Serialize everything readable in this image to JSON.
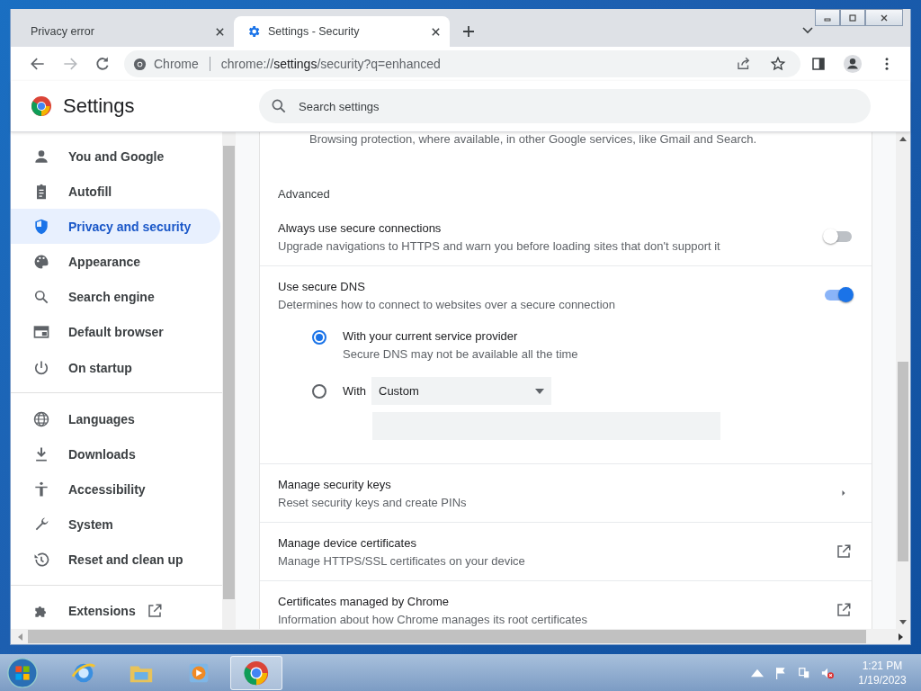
{
  "tabs": [
    {
      "label": "Privacy error",
      "selected": false
    },
    {
      "label": "Settings - Security",
      "selected": true
    }
  ],
  "toolbar": {
    "nav": [
      {
        "disabled": false
      },
      {
        "disabled": true
      },
      {
        "disabled": false
      }
    ],
    "site_chip": "Chrome",
    "url": [
      {
        "text": "chrome://",
        "emphasized": false
      },
      {
        "text": "settings",
        "emphasized": true
      },
      {
        "text": "/security?q=enhanced",
        "emphasized": false
      }
    ]
  },
  "settings": {
    "title": "Settings",
    "search": {
      "placeholder": "Search settings"
    }
  },
  "sidebar": {
    "groups": [
      [
        {
          "label": "You and Google",
          "selected": false
        },
        {
          "label": "Autofill",
          "selected": false
        },
        {
          "label": "Privacy and security",
          "selected": true
        },
        {
          "label": "Appearance",
          "selected": false
        },
        {
          "label": "Search engine",
          "selected": false
        },
        {
          "label": "Default browser",
          "selected": false
        },
        {
          "label": "On startup",
          "selected": false
        }
      ],
      [
        {
          "label": "Languages",
          "selected": false
        },
        {
          "label": "Downloads",
          "selected": false
        },
        {
          "label": "Accessibility",
          "selected": false
        },
        {
          "label": "System",
          "selected": false
        },
        {
          "label": "Reset and clean up",
          "selected": false
        }
      ],
      [
        {
          "label": "Extensions",
          "selected": false,
          "external": true
        }
      ]
    ]
  },
  "content": {
    "partial_text": "Browsing protection, where available, in other Google services, like Gmail and Search.",
    "section_title": "Advanced",
    "rows": [
      {
        "kind": "toggle",
        "title": "Always use secure connections",
        "subtitle": "Upgrade navigations to HTTPS and warn you before loading sites that don't support it",
        "on": false
      },
      {
        "kind": "toggle",
        "title": "Use secure DNS",
        "subtitle": "Determines how to connect to websites over a secure connection",
        "on": true,
        "options": [
          {
            "label": "With your current service provider",
            "subtitle": "Secure DNS may not be available all the time",
            "selected": true
          },
          {
            "label": "With",
            "dropdown": "Custom",
            "selected": false
          }
        ]
      },
      {
        "kind": "arrow",
        "title": "Manage security keys",
        "subtitle": "Reset security keys and create PINs"
      },
      {
        "kind": "external",
        "title": "Manage device certificates",
        "subtitle": "Manage HTTPS/SSL certificates on your device"
      },
      {
        "kind": "external",
        "title": "Certificates managed by Chrome",
        "subtitle": "Information about how Chrome manages its root certificates"
      }
    ]
  },
  "taskbar": {
    "apps": [
      {
        "selected": false
      },
      {
        "selected": false
      },
      {
        "selected": false
      },
      {
        "selected": true
      }
    ],
    "time": "1:21 PM",
    "date": "1/19/2023"
  }
}
